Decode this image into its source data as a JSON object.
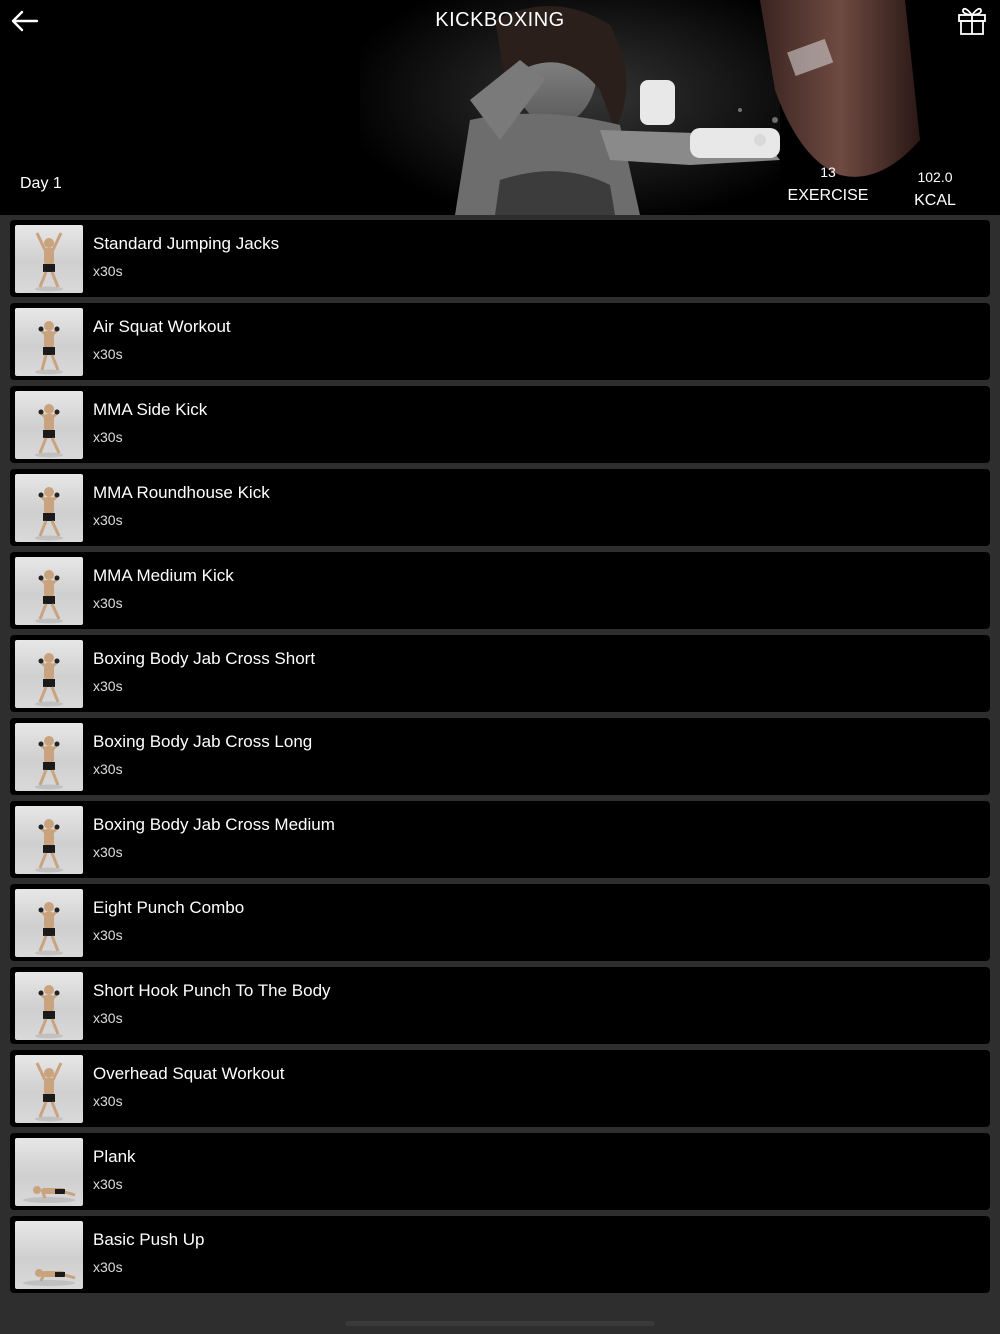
{
  "header": {
    "title": "KICKBOXING",
    "day": "Day 1",
    "exercise_count": "13",
    "exercise_label": "EXERCISE",
    "kcal_value": "102.0",
    "kcal_label": "KCAL",
    "back_icon": "arrow-left-icon",
    "gift_icon": "gift-icon"
  },
  "exercises": [
    {
      "name": "Standard Jumping Jacks",
      "duration": "x30s"
    },
    {
      "name": "Air Squat Workout",
      "duration": "x30s"
    },
    {
      "name": "MMA Side Kick",
      "duration": "x30s"
    },
    {
      "name": "MMA Roundhouse Kick",
      "duration": "x30s"
    },
    {
      "name": "MMA Medium Kick",
      "duration": "x30s"
    },
    {
      "name": "Boxing Body Jab Cross Short",
      "duration": "x30s"
    },
    {
      "name": "Boxing Body Jab Cross Long",
      "duration": "x30s"
    },
    {
      "name": "Boxing Body Jab Cross Medium",
      "duration": "x30s"
    },
    {
      "name": "Eight Punch Combo",
      "duration": "x30s"
    },
    {
      "name": "Short Hook Punch To The Body",
      "duration": "x30s"
    },
    {
      "name": "Overhead Squat Workout",
      "duration": "x30s"
    },
    {
      "name": "Plank",
      "duration": "x30s"
    },
    {
      "name": "Basic Push Up",
      "duration": "x30s"
    }
  ]
}
